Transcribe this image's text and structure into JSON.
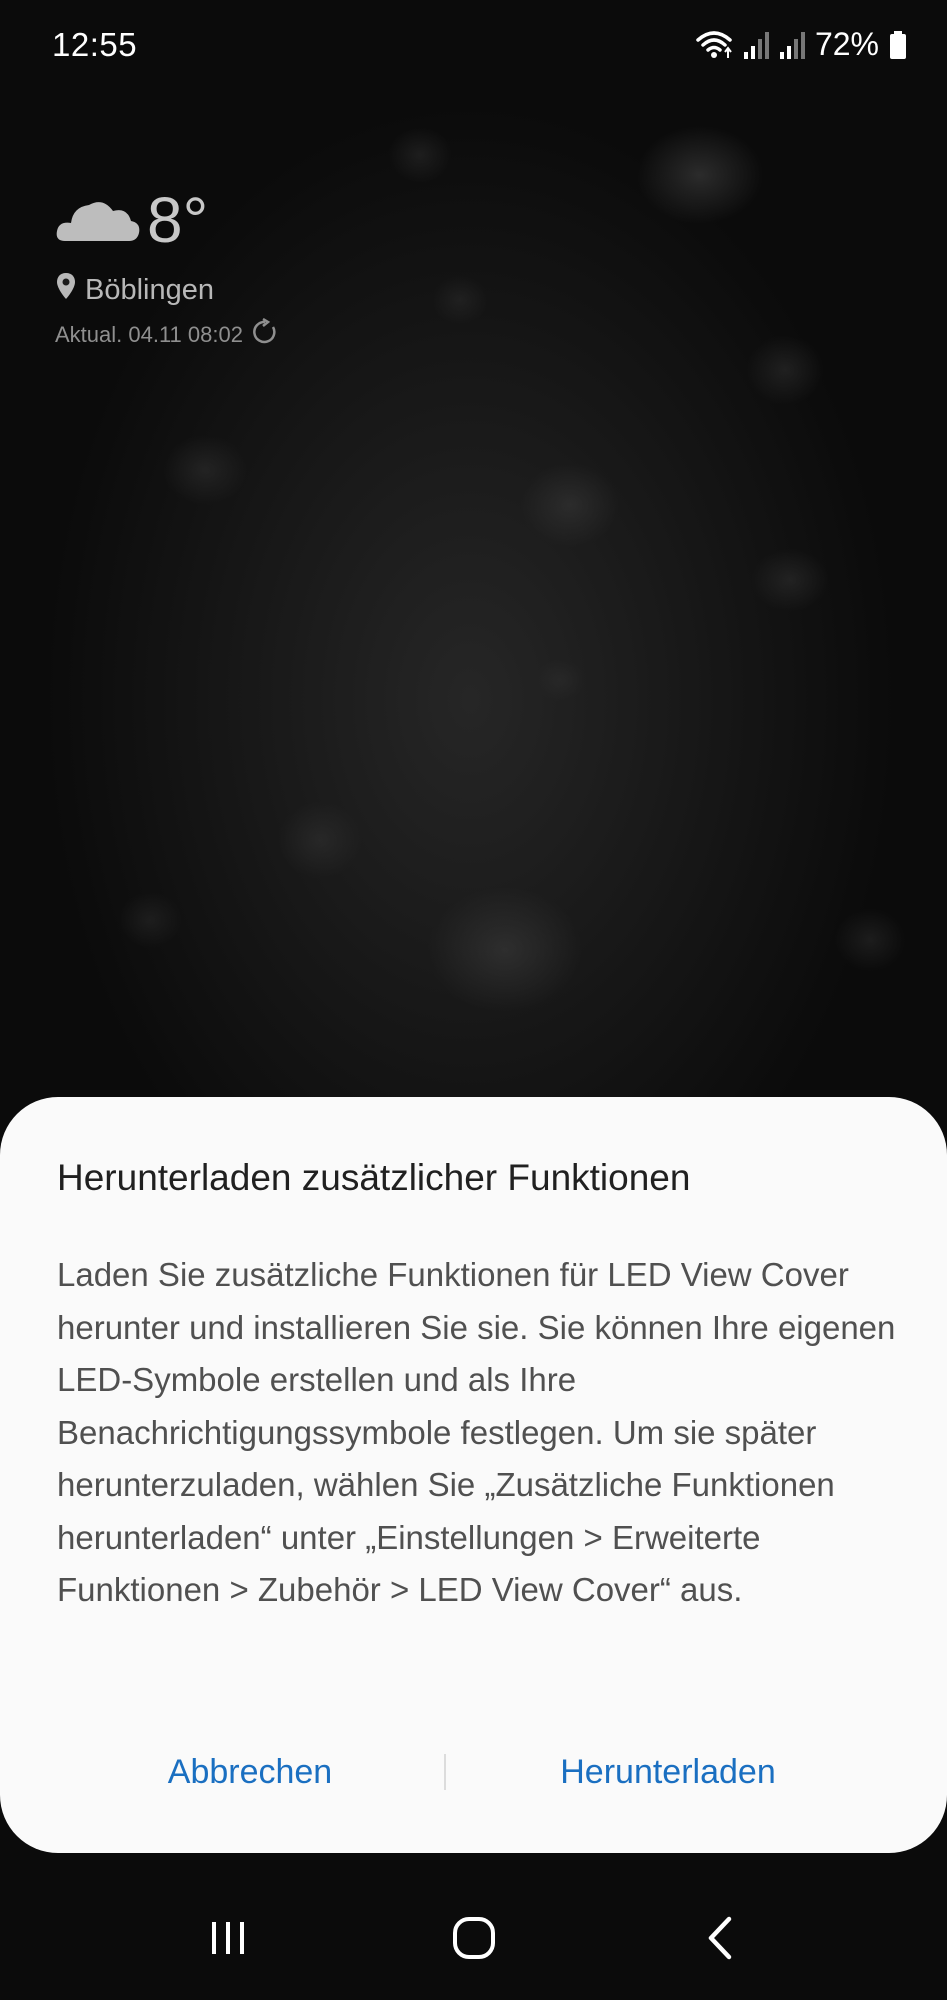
{
  "status_bar": {
    "time": "12:55",
    "battery_percent": "72%",
    "icons": [
      "wifi-icon",
      "signal-icon",
      "signal-icon",
      "battery-icon"
    ]
  },
  "weather": {
    "icon": "cloud-icon",
    "temperature": "8°",
    "location": "Böblingen",
    "updated": "Aktual. 04.11 08:02"
  },
  "dialog": {
    "title": "Herunterladen zusätzlicher Funktionen",
    "body": "Laden Sie zusätzliche Funktionen für LED View Cover herunter und installieren Sie sie. Sie können Ihre eigenen LED-Symbole erstellen und als Ihre Benachrichtigungssymbole festlegen. Um sie später herunterzuladen, wählen Sie „Zusätzliche Funktionen herunterladen“ unter „Einstellungen > Erweiterte Funktionen > Zubehör > LED View Cover“ aus.",
    "cancel_label": "Abbrechen",
    "download_label": "Herunterladen"
  },
  "nav_bar": {
    "icons": [
      "recents-icon",
      "home-icon",
      "back-icon"
    ]
  },
  "colors": {
    "accent": "#1a6fc1",
    "dialog_bg": "#fafafa"
  }
}
